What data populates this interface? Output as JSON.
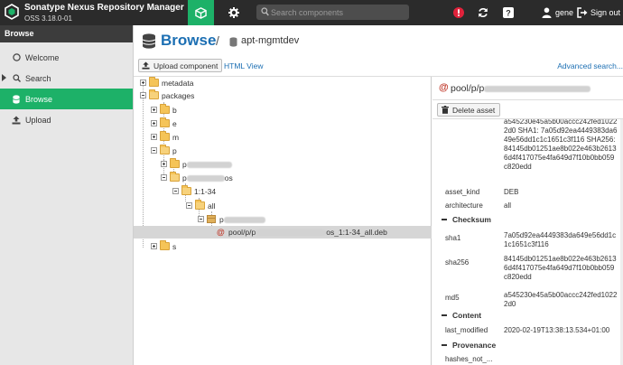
{
  "app": {
    "title": "Sonatype Nexus Repository Manager",
    "version": "OSS 3.18.0-01"
  },
  "topbar": {
    "search_placeholder": "Search components",
    "user_name": "gene",
    "signout_label": "Sign out",
    "icons": [
      "cube-icon",
      "gear-icon",
      "search-icon",
      "alert-icon",
      "refresh-icon",
      "help-icon",
      "user-icon",
      "signout-icon"
    ],
    "colors": {
      "bar": "#2b2b2b",
      "accent": "#1db168",
      "alert": "#e0223b"
    }
  },
  "leftnav": {
    "header": "Browse",
    "items": [
      {
        "label": "Welcome",
        "icon": "circle-icon",
        "active": false
      },
      {
        "label": "Search",
        "icon": "search-icon",
        "active": false,
        "expandable": true
      },
      {
        "label": "Browse",
        "icon": "database-icon",
        "active": true
      },
      {
        "label": "Upload",
        "icon": "upload-icon",
        "active": false
      }
    ]
  },
  "main": {
    "title": "Browse",
    "repository": "apt-mgmtdev"
  },
  "toolbar": {
    "upload_label": "Upload component",
    "html_view_label": "HTML View",
    "advanced_search_label": "Advanced search..."
  },
  "tree": {
    "nodes": [
      {
        "label": "metadata"
      },
      {
        "label": "packages"
      },
      {
        "label": "b"
      },
      {
        "label": "e"
      },
      {
        "label": "m"
      },
      {
        "label": "p"
      },
      {
        "label": "p"
      },
      {
        "label": "p",
        "suffix": "os"
      },
      {
        "label": "1:1-34"
      },
      {
        "label": "all"
      },
      {
        "label": "p"
      },
      {
        "label": "pool/p/p",
        "suffix": "os_1:1-34_all.deb"
      },
      {
        "label": "s"
      }
    ]
  },
  "detail": {
    "title": "pool/p/p",
    "delete_label": "Delete asset",
    "top_value": "a545230e45a5b00accc242fed10222d0 SHA1: 7a05d92ea4449383da649e56dd1c1c1651c3f116 SHA256: 84145db01251ae8b022e463b26136d4f417075e4fa649d7f10b0bb059c820edd",
    "attributes": [
      {
        "key": "asset_kind",
        "value": "DEB"
      },
      {
        "key": "architecture",
        "value": "all"
      }
    ],
    "sections": [
      {
        "title": "Checksum",
        "rows": [
          {
            "key": "sha1",
            "value": "7a05d92ea4449383da649e56dd1c1c1651c3f116"
          },
          {
            "key": "sha256",
            "value": "84145db01251ae8b022e463b26136d4f417075e4fa649d7f10b0bb059c820edd"
          },
          {
            "key": "md5",
            "value": "a545230e45a5b00accc242fed10222d0"
          }
        ]
      },
      {
        "title": "Content",
        "rows": [
          {
            "key": "last_modified",
            "value": "2020-02-19T13:38:13.534+01:00"
          }
        ]
      },
      {
        "title": "Provenance",
        "rows": [
          {
            "key": "hashes_not_...",
            "value": ""
          }
        ]
      }
    ]
  }
}
